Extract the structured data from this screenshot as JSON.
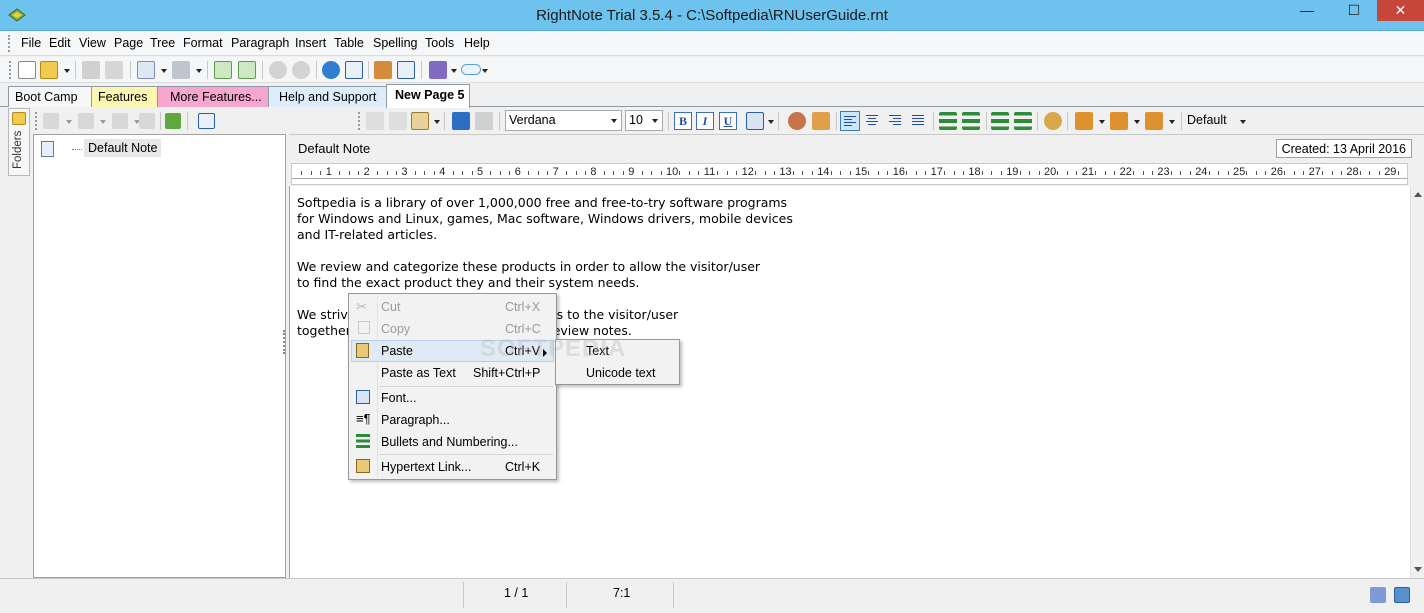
{
  "window": {
    "title": "RightNote Trial 3.5.4 - C:\\Softpedia\\RNUserGuide.rnt",
    "minimize": "—",
    "maximize": "☐",
    "close": "✕"
  },
  "menu": [
    "File",
    "Edit",
    "View",
    "Page",
    "Tree",
    "Format",
    "Paragraph",
    "Insert",
    "Table",
    "Spelling",
    "Tools",
    "Help"
  ],
  "tabs": [
    {
      "label": "Boot Camp",
      "color": "#f7f7f7"
    },
    {
      "label": "Features",
      "color": "#fbf6b0"
    },
    {
      "label": "More Features...",
      "color": "#f7a6cf"
    },
    {
      "label": "Help and Support",
      "color": "#dcecfb"
    },
    {
      "label": "New Page 5",
      "color": "#ffffff",
      "active": true
    }
  ],
  "sidebar": {
    "folders_label": "Folders",
    "tree_items": [
      "Default Note"
    ]
  },
  "format": {
    "font_name": "Verdana",
    "font_size": "10",
    "bold": "B",
    "italic": "I",
    "underline": "U",
    "style": "Default"
  },
  "note": {
    "title": "Default Note",
    "created": "Created: 13 April 2016",
    "paragraphs": [
      [
        "Softpedia is a library of over 1,000,000 free and free-to-try software programs",
        "for Windows and Linux, games, Mac software, Windows drivers, mobile devices",
        "and IT-related articles."
      ],
      [
        "We review and categorize these products in order to allow the visitor/user",
        "to find the exact product they and their system needs."
      ],
      [
        "We strive to deliver only the best products to the visitor/user",
        "together with self-made evaluation and review notes."
      ]
    ]
  },
  "ruler": [
    "1",
    "2",
    "3",
    "4",
    "5",
    "6",
    "7",
    "8",
    "9",
    "10",
    "11",
    "12",
    "13",
    "14",
    "15",
    "16",
    "17",
    "18",
    "19",
    "20",
    "21",
    "22",
    "23",
    "24",
    "25",
    "26",
    "27",
    "28",
    "29"
  ],
  "context_menu": {
    "cut": {
      "label": "Cut",
      "shortcut": "Ctrl+X"
    },
    "copy": {
      "label": "Copy",
      "shortcut": "Ctrl+C"
    },
    "paste": {
      "label": "Paste",
      "shortcut": "Ctrl+V"
    },
    "paste_as_text": {
      "label": "Paste as Text",
      "shortcut": "Shift+Ctrl+P"
    },
    "font": {
      "label": "Font..."
    },
    "paragraph": {
      "label": "Paragraph..."
    },
    "bullets": {
      "label": "Bullets and Numbering..."
    },
    "hyperlink": {
      "label": "Hypertext Link...",
      "shortcut": "Ctrl+K"
    }
  },
  "paste_submenu": [
    "Text",
    "Unicode text"
  ],
  "watermark": "SOFTPEDIA",
  "status": {
    "page": "1 / 1",
    "position": "7:1"
  }
}
